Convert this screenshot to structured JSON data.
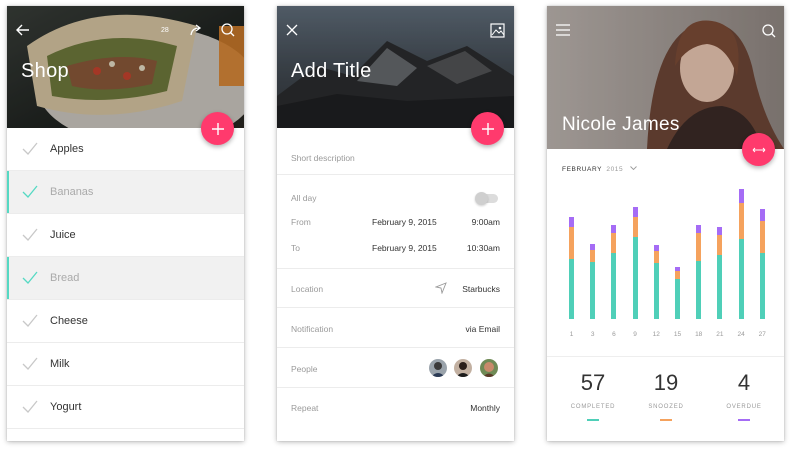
{
  "shop": {
    "title": "Shop",
    "badge": "28",
    "items": [
      {
        "label": "Apples",
        "done": false
      },
      {
        "label": "Bananas",
        "done": true
      },
      {
        "label": "Juice",
        "done": false
      },
      {
        "label": "Bread",
        "done": true
      },
      {
        "label": "Cheese",
        "done": false
      },
      {
        "label": "Milk",
        "done": false
      },
      {
        "label": "Yogurt",
        "done": false
      }
    ]
  },
  "event": {
    "title": "Add Title",
    "description_placeholder": "Short description",
    "all_day_label": "All day",
    "from_label": "From",
    "from_date": "February 9, 2015",
    "from_time": "9:00am",
    "to_label": "To",
    "to_date": "February 9, 2015",
    "to_time": "10:30am",
    "location_label": "Location",
    "location_value": "Starbucks",
    "notification_label": "Notification",
    "notification_value": "via Email",
    "people_label": "People",
    "repeat_label": "Repeat",
    "repeat_value": "Monthly"
  },
  "profile": {
    "name": "Nicole James",
    "month": "FEBRUARY",
    "year": "2015",
    "stats": [
      {
        "value": "57",
        "label": "COMPLETED",
        "color": "#4fcfb8"
      },
      {
        "value": "19",
        "label": "SNOOZED",
        "color": "#f5a25d"
      },
      {
        "value": "4",
        "label": "OVERDUE",
        "color": "#a56cf5"
      }
    ]
  },
  "colors": {
    "accent": "#ff3a6d",
    "teal": "#4fcfb8",
    "orange": "#f5a25d",
    "purple": "#a56cf5"
  },
  "chart_data": {
    "type": "bar",
    "stacked": true,
    "categories": [
      "1",
      "3",
      "6",
      "9",
      "12",
      "15",
      "18",
      "21",
      "24",
      "27"
    ],
    "series": [
      {
        "name": "COMPLETED",
        "color": "#4fcfb8",
        "values": [
          60,
          57,
          66,
          82,
          56,
          40,
          58,
          64,
          80,
          66
        ]
      },
      {
        "name": "SNOOZED",
        "color": "#f5a25d",
        "values": [
          32,
          12,
          20,
          20,
          12,
          8,
          28,
          20,
          36,
          32
        ]
      },
      {
        "name": "OVERDUE",
        "color": "#a56cf5",
        "values": [
          10,
          6,
          8,
          10,
          6,
          4,
          8,
          8,
          14,
          12
        ]
      }
    ],
    "ylim": [
      0,
      130
    ],
    "grid": false
  }
}
